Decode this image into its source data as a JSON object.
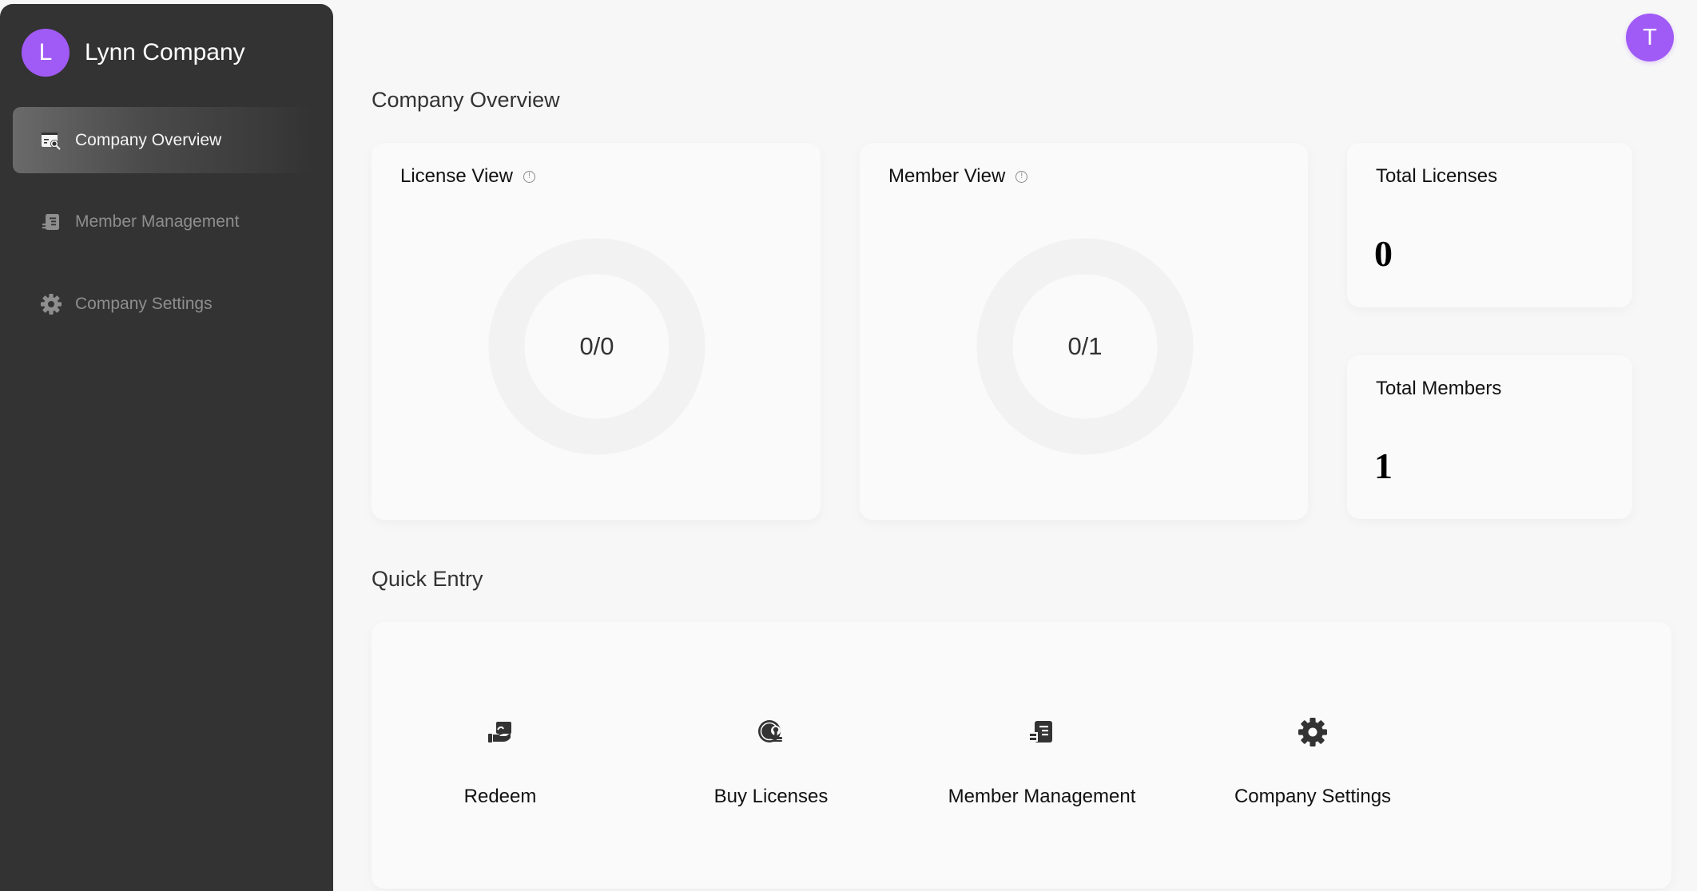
{
  "sidebar": {
    "brand": {
      "initial": "L",
      "name": "Lynn Company"
    },
    "items": [
      {
        "label": "Company Overview",
        "icon": "overview-search-icon",
        "active": true
      },
      {
        "label": "Member Management",
        "icon": "member-list-icon",
        "active": false
      },
      {
        "label": "Company Settings",
        "icon": "gear-icon",
        "active": false
      }
    ]
  },
  "header": {
    "user_initial": "T"
  },
  "overview": {
    "title": "Company Overview",
    "license_view": {
      "title": "License View",
      "info_icon": "info-icon",
      "value": "0/0",
      "used": 0,
      "total": 0
    },
    "member_view": {
      "title": "Member View",
      "info_icon": "info-icon",
      "value": "0/1",
      "used": 0,
      "total": 1
    },
    "total_licenses": {
      "title": "Total Licenses",
      "value": "0"
    },
    "total_members": {
      "title": "Total Members",
      "value": "1"
    }
  },
  "quick_entry": {
    "title": "Quick Entry",
    "items": [
      {
        "label": "Redeem",
        "icon": "redeem-hand-card-icon"
      },
      {
        "label": "Buy Licenses",
        "icon": "buy-license-badge-icon"
      },
      {
        "label": "Member Management",
        "icon": "member-list-icon"
      },
      {
        "label": "Company Settings",
        "icon": "gear-icon"
      }
    ]
  },
  "colors": {
    "accent": "#a05af5",
    "sidebar_bg": "#333333",
    "page_bg": "#f7f7f7",
    "card_bg": "#fafafa",
    "donut_track": "#f2f2f2"
  }
}
